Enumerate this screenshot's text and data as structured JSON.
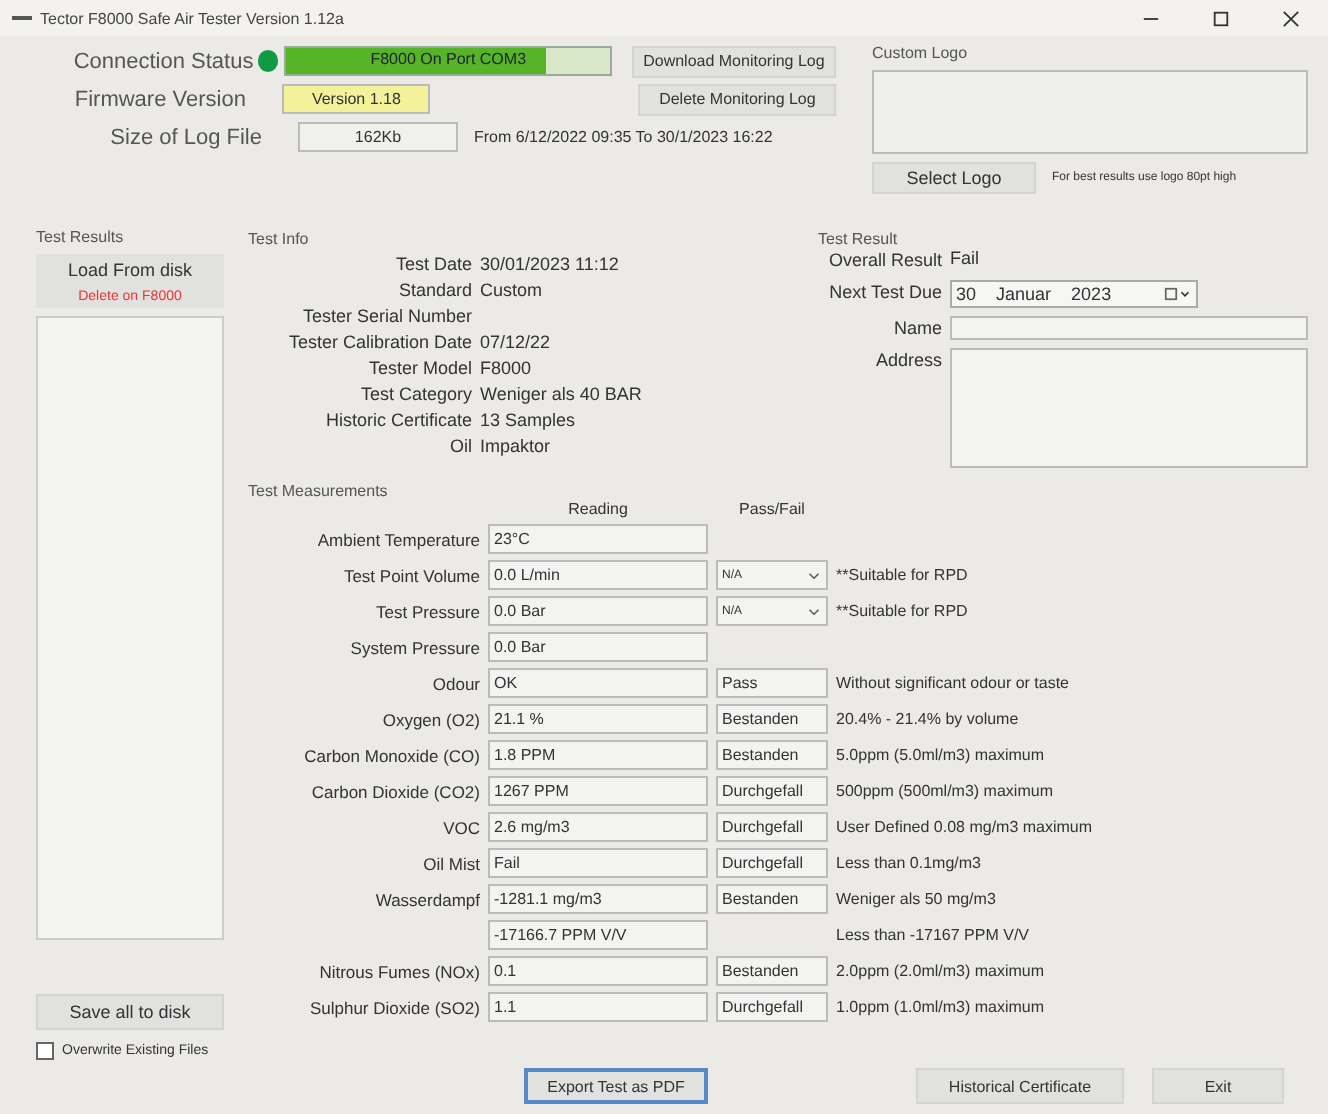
{
  "window": {
    "title": "Tector F8000 Safe Air Tester Version 1.12a"
  },
  "connection": {
    "label": "Connection Status",
    "connected": true,
    "status": "F8000 On Port COM3",
    "level": 0.8
  },
  "firmware": {
    "label": "Firmware Version",
    "value": "Version 1.18"
  },
  "log_file": {
    "label": "Size of Log File",
    "value": "162Kb",
    "range": "From 6/12/2022 09:35  To 30/1/2023 16:22"
  },
  "log_buttons": [
    "Download Monitoring Log",
    "Delete Monitoring Log"
  ],
  "custom_logo": {
    "title": "Custom Logo",
    "button": "Select Logo",
    "hint": "For best results use logo 80pt high"
  },
  "test_results": {
    "title": "Test Results",
    "load_button": "Load From disk",
    "delete_button": "Delete on F8000",
    "save_button": "Save all to disk",
    "overwrite": {
      "label": "Overwrite Existing Files",
      "checked": false
    }
  },
  "test_info": {
    "title": "Test Info",
    "fields": [
      {
        "label": "Test Date",
        "value": "30/01/2023  11:12"
      },
      {
        "label": "Standard",
        "value": "Custom"
      },
      {
        "label": "Tester Serial Number"
      },
      {
        "label": "Tester Calibration Date",
        "value": "07/12/22"
      },
      {
        "label": "Tester Model",
        "value": "F8000"
      },
      {
        "label": "Test Category",
        "value": "Weniger als 40 BAR"
      },
      {
        "label": "Historic Certificate",
        "value": "13 Samples"
      },
      {
        "label": "Oil",
        "value": "Impaktor"
      }
    ]
  },
  "test_result": {
    "title": "Test Result",
    "overall_label": "Overall Result",
    "overall": "Fail",
    "next_due_label": "Next Test Due",
    "next_due": {
      "day": "30",
      "month": "Januar",
      "year": "2023"
    },
    "name_label": "Name",
    "address_label": "Address"
  },
  "measurements": {
    "title": "Test Measurements",
    "columns": [
      "Reading",
      "Pass/Fail"
    ],
    "rows": [
      {
        "label": "Ambient Temperature",
        "reading": "23°C"
      },
      {
        "label": "Test Point Volume",
        "reading": "0.0 L/min",
        "pass_fail": {
          "kind": "select",
          "value": "N/A"
        },
        "note": "**Suitable for RPD"
      },
      {
        "label": "Test Pressure",
        "reading": "0.0 Bar",
        "pass_fail": {
          "kind": "select",
          "value": "N/A"
        },
        "note": "**Suitable for RPD"
      },
      {
        "label": "System Pressure",
        "reading": "0.0 Bar"
      },
      {
        "label": "Odour",
        "reading": "OK",
        "pass_fail": {
          "kind": "text",
          "value": "Pass"
        },
        "note": "Without significant odour or taste"
      },
      {
        "label": "Oxygen (O2)",
        "reading": "21.1 %",
        "pass_fail": {
          "kind": "text",
          "value": "Bestanden"
        },
        "note": "20.4% - 21.4% by volume"
      },
      {
        "label": "Carbon Monoxide (CO)",
        "reading": "1.8 PPM",
        "pass_fail": {
          "kind": "text",
          "value": "Bestanden"
        },
        "note": "5.0ppm (5.0ml/m3) maximum"
      },
      {
        "label": "Carbon Dioxide (CO2)",
        "reading": "1267 PPM",
        "pass_fail": {
          "kind": "text",
          "value": "Durchgefall"
        },
        "note": "500ppm (500ml/m3) maximum"
      },
      {
        "label": "VOC",
        "reading": "2.6 mg/m3",
        "pass_fail": {
          "kind": "text",
          "value": "Durchgefall"
        },
        "note": "User Defined 0.08 mg/m3 maximum"
      },
      {
        "label": "Oil Mist",
        "reading": "Fail",
        "pass_fail": {
          "kind": "text",
          "value": "Durchgefall"
        },
        "note": "Less than 0.1mg/m3"
      },
      {
        "label": "Wasserdampf",
        "reading": "-1281.1 mg/m3",
        "pass_fail": {
          "kind": "text",
          "value": "Bestanden"
        },
        "note": "Weniger als 50 mg/m3"
      },
      {
        "reading": "-17166.7 PPM V/V",
        "note": "Less than -17167 PPM V/V"
      },
      {
        "label": "Nitrous Fumes (NOx)",
        "reading": "0.1",
        "pass_fail": {
          "kind": "text",
          "value": "Bestanden"
        },
        "note": "2.0ppm (2.0ml/m3) maximum"
      },
      {
        "label": "Sulphur Dioxide (SO2)",
        "reading": "1.1",
        "pass_fail": {
          "kind": "text",
          "value": "Durchgefall"
        },
        "note": "1.0ppm (1.0ml/m3) maximum"
      }
    ]
  },
  "bottom_buttons": [
    {
      "label": "Export Test as PDF",
      "focused": true
    },
    {
      "label": "Historical Certificate",
      "focused": false
    },
    {
      "label": "Exit",
      "focused": false
    }
  ]
}
